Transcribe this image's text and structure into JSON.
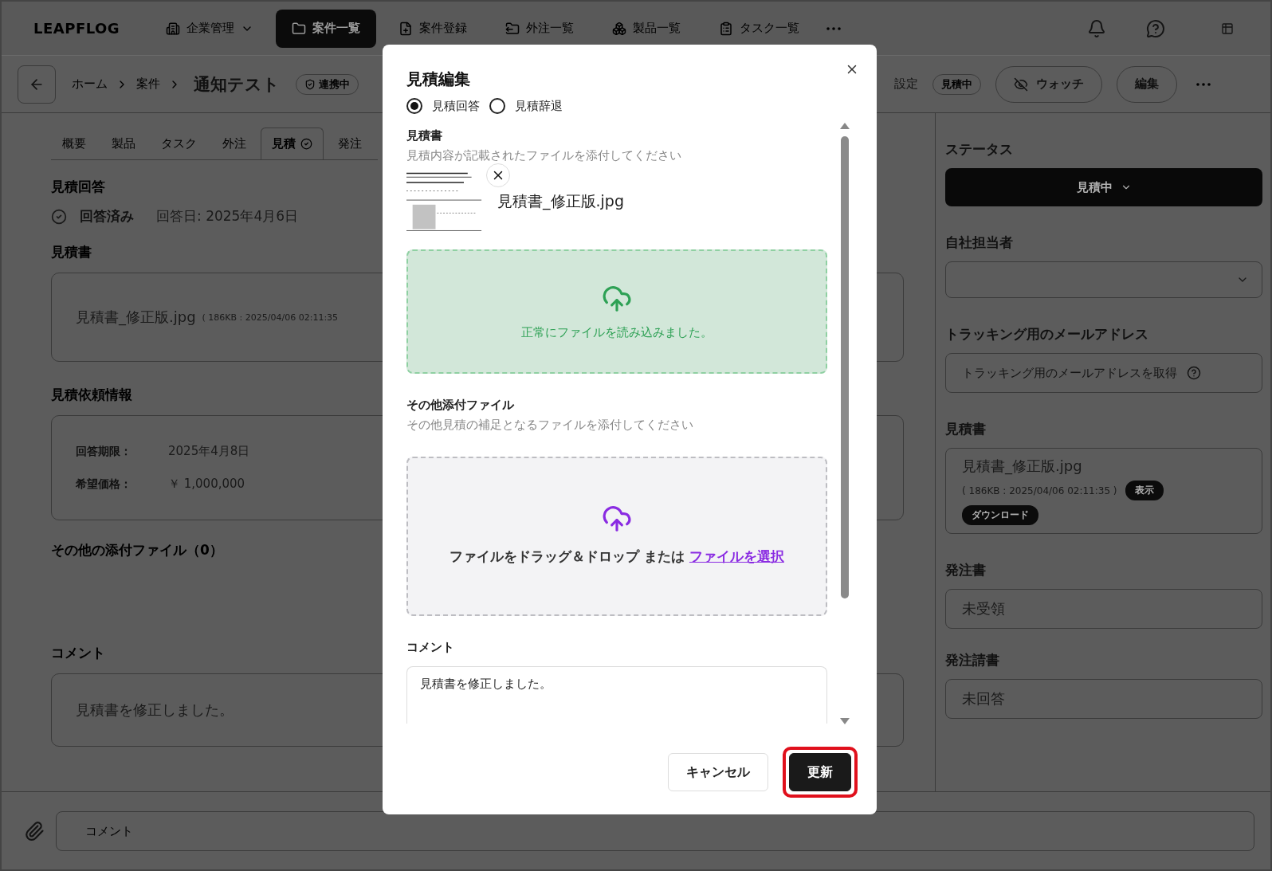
{
  "nav": {
    "logo": "LEAPFLOG",
    "items": [
      {
        "label": "企業管理",
        "selected": false,
        "dropdown": true
      },
      {
        "label": "案件一覧",
        "selected": true,
        "dropdown": false
      },
      {
        "label": "案件登録",
        "selected": false,
        "dropdown": false
      },
      {
        "label": "外注一覧",
        "selected": false,
        "dropdown": false
      },
      {
        "label": "製品一覧",
        "selected": false,
        "dropdown": false
      },
      {
        "label": "タスク一覧",
        "selected": false,
        "dropdown": false
      }
    ]
  },
  "header": {
    "breadcrumbs": [
      "ホーム",
      "案件"
    ],
    "title": "通知テスト",
    "tag": "連携中",
    "settings": "設定",
    "status_tag": "見積中",
    "watch": "ウォッチ",
    "edit": "編集"
  },
  "tabs": [
    {
      "label": "概要",
      "selected": false,
      "badge": false
    },
    {
      "label": "製品",
      "selected": false,
      "badge": false
    },
    {
      "label": "タスク",
      "selected": false,
      "badge": false
    },
    {
      "label": "外注",
      "selected": false,
      "badge": false
    },
    {
      "label": "見積",
      "selected": true,
      "badge": true
    },
    {
      "label": "発注",
      "selected": false,
      "badge": false
    }
  ],
  "quote_answer": {
    "heading": "見積回答",
    "status": "回答済み",
    "date": "回答日: 2025年4月6日"
  },
  "quote_doc": {
    "heading": "見積書",
    "file_name": "見積書_修正版.jpg",
    "file_meta": "( 186KB : 2025/04/06 02:11:35"
  },
  "request_info": {
    "heading": "見積依頼情報",
    "rows": [
      {
        "label": "回答期限：",
        "value": "2025年4月8日"
      },
      {
        "label": "希望価格：",
        "value": "￥ 1,000,000"
      }
    ]
  },
  "other_files": {
    "heading": "その他の添付ファイル（0）"
  },
  "comment": {
    "heading": "コメント",
    "text": "見積書を修正しました。"
  },
  "sidebar": {
    "status": {
      "heading": "ステータス",
      "value": "見積中"
    },
    "assignee": {
      "heading": "自社担当者"
    },
    "tracking": {
      "heading": "トラッキング用のメールアドレス",
      "action": "トラッキング用のメールアドレスを取得"
    },
    "quote": {
      "heading": "見積書",
      "file_name": "見積書_修正版.jpg",
      "file_meta": "( 186KB : 2025/04/06 02:11:35 )",
      "view": "表示",
      "download": "ダウンロード"
    },
    "order": {
      "heading": "発注書",
      "value": "未受領"
    },
    "order_ack": {
      "heading": "発注請書",
      "value": "未回答"
    }
  },
  "comment_bar": {
    "placeholder": "コメント"
  },
  "modal": {
    "title": "見積編集",
    "answer_options": [
      {
        "label": "見積回答",
        "selected": true
      },
      {
        "label": "見積辞退",
        "selected": false
      }
    ],
    "quote_section": {
      "label": "見積書",
      "hint": "見積内容が記載されたファイルを添付してください",
      "file_name": "見積書_修正版.jpg",
      "success": "正常にファイルを読み込みました。"
    },
    "other_section": {
      "label": "その他添付ファイル",
      "hint": "その他見積の補足となるファイルを添付してください",
      "drop_text": "ファイルをドラッグ＆ドロップ または",
      "select_link": "ファイルを選択"
    },
    "comment": {
      "label": "コメント",
      "value": "見積書を修正しました。"
    },
    "buttons": [
      {
        "label": "キャンセル",
        "kind": "secondary",
        "highlighted": false
      },
      {
        "label": "更新",
        "kind": "primary",
        "highlighted": true
      }
    ]
  }
}
